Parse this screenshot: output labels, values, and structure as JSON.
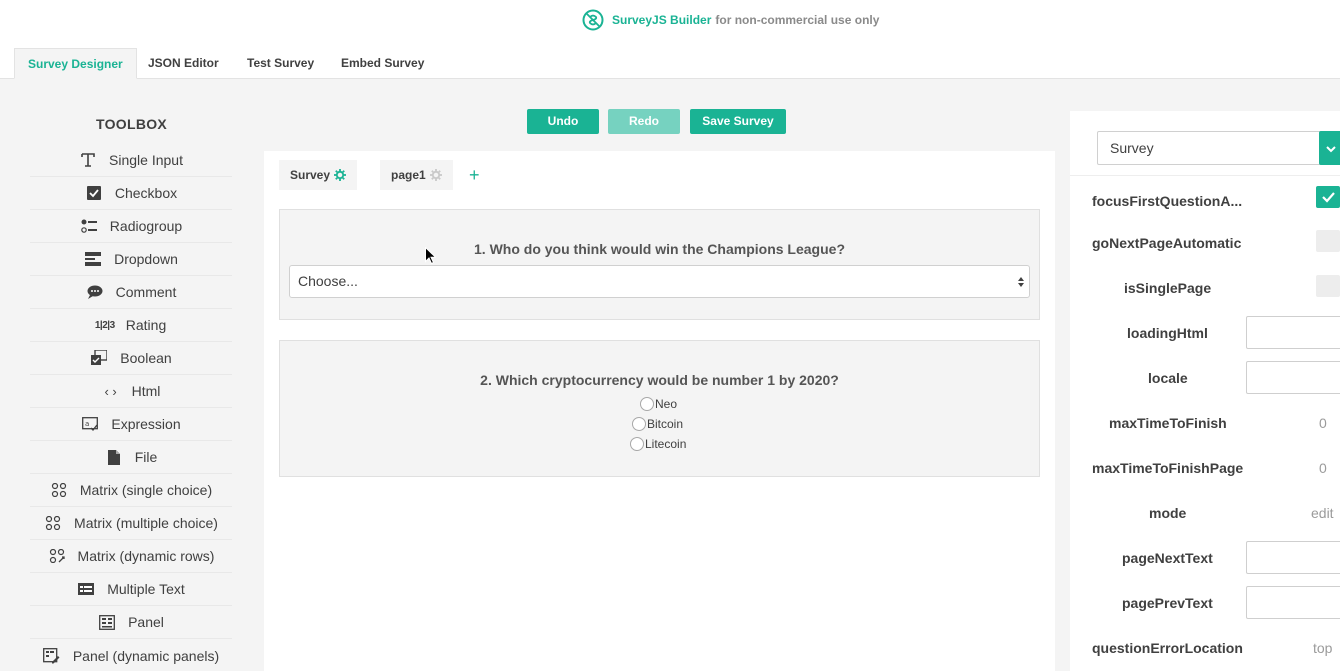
{
  "banner": {
    "brand": "SurveyJS Builder",
    "note": "for non-commercial use only",
    "logo_icon": "surveyjs-logo-icon"
  },
  "tabs": [
    {
      "label": "Survey Designer",
      "active": true
    },
    {
      "label": "JSON Editor",
      "active": false
    },
    {
      "label": "Test Survey",
      "active": false
    },
    {
      "label": "Embed Survey",
      "active": false
    }
  ],
  "toolbox": {
    "title": "TOOLBOX",
    "items": [
      {
        "label": "Single Input",
        "icon": "text-input-icon"
      },
      {
        "label": "Checkbox",
        "icon": "checkbox-icon"
      },
      {
        "label": "Radiogroup",
        "icon": "radiogroup-icon"
      },
      {
        "label": "Dropdown",
        "icon": "dropdown-icon"
      },
      {
        "label": "Comment",
        "icon": "comment-icon"
      },
      {
        "label": "Rating",
        "icon": "rating-icon"
      },
      {
        "label": "Boolean",
        "icon": "boolean-icon"
      },
      {
        "label": "Html",
        "icon": "html-icon"
      },
      {
        "label": "Expression",
        "icon": "expression-icon"
      },
      {
        "label": "File",
        "icon": "file-icon"
      },
      {
        "label": "Matrix (single choice)",
        "icon": "matrix-single-icon"
      },
      {
        "label": "Matrix (multiple choice)",
        "icon": "matrix-multiple-icon"
      },
      {
        "label": "Matrix (dynamic rows)",
        "icon": "matrix-dynamic-icon"
      },
      {
        "label": "Multiple Text",
        "icon": "multiple-text-icon"
      },
      {
        "label": "Panel",
        "icon": "panel-icon"
      },
      {
        "label": "Panel (dynamic panels)",
        "icon": "panel-dynamic-icon"
      }
    ]
  },
  "actions": {
    "undo": "Undo",
    "redo": "Redo",
    "save": "Save Survey"
  },
  "editor": {
    "page_tabs": [
      {
        "label": "Survey"
      },
      {
        "label": "page1"
      }
    ],
    "questions": [
      {
        "title": "1. Who do you think would win the Champions League?",
        "type": "dropdown",
        "placeholder": "Choose..."
      },
      {
        "title": "2. Which cryptocurrency would be number 1 by 2020?",
        "type": "radiogroup",
        "choices": [
          "Neo",
          "Bitcoin",
          "Litecoin"
        ]
      }
    ]
  },
  "properties": {
    "selected_object": "Survey",
    "rows": [
      {
        "name": "focusFirstQuestionA...",
        "kind": "checkbox",
        "checked": true
      },
      {
        "name": "goNextPageAutomatic",
        "kind": "checkbox",
        "checked": false
      },
      {
        "name": "isSinglePage",
        "kind": "checkbox",
        "checked": false
      },
      {
        "name": "loadingHtml",
        "kind": "input",
        "value": ""
      },
      {
        "name": "locale",
        "kind": "input",
        "value": ""
      },
      {
        "name": "maxTimeToFinish",
        "kind": "value",
        "value": "0"
      },
      {
        "name": "maxTimeToFinishPage",
        "kind": "value",
        "value": "0"
      },
      {
        "name": "mode",
        "kind": "value",
        "value": "edit"
      },
      {
        "name": "pageNextText",
        "kind": "input",
        "value": ""
      },
      {
        "name": "pagePrevText",
        "kind": "input",
        "value": ""
      },
      {
        "name": "questionErrorLocation",
        "kind": "value",
        "value": "top"
      }
    ]
  },
  "colors": {
    "accent": "#1ab394",
    "accent_disabled": "#76d2c0",
    "canvas": "#f4f4f4",
    "text": "#404040"
  }
}
